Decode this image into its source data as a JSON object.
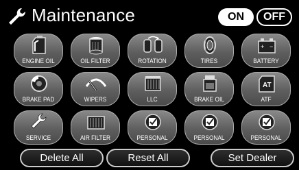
{
  "header": {
    "title": "Maintenance",
    "on_label": "ON",
    "off_label": "OFF"
  },
  "items": [
    {
      "label": "ENGINE OIL",
      "icon": "engine-oil-icon"
    },
    {
      "label": "OIL FILTER",
      "icon": "oil-filter-icon"
    },
    {
      "label": "ROTATION",
      "icon": "rotation-icon"
    },
    {
      "label": "TIRES",
      "icon": "tires-icon"
    },
    {
      "label": "BATTERY",
      "icon": "battery-icon"
    },
    {
      "label": "BRAKE PAD",
      "icon": "brake-pad-icon"
    },
    {
      "label": "WIPERS",
      "icon": "wipers-icon"
    },
    {
      "label": "LLC",
      "icon": "llc-icon"
    },
    {
      "label": "BRAKE OIL",
      "icon": "brake-oil-icon"
    },
    {
      "label": "ATF",
      "icon": "atf-icon"
    },
    {
      "label": "SERVICE",
      "icon": "service-icon"
    },
    {
      "label": "AIR FILTER",
      "icon": "air-filter-icon"
    },
    {
      "label": "PERSONAL",
      "icon": "personal-icon"
    },
    {
      "label": "PERSONAL",
      "icon": "personal-icon"
    },
    {
      "label": "PERSONAL",
      "icon": "personal-icon"
    }
  ],
  "buttons": {
    "delete_all": "Delete All",
    "reset_all": "Reset All",
    "set_dealer": "Set Dealer"
  }
}
